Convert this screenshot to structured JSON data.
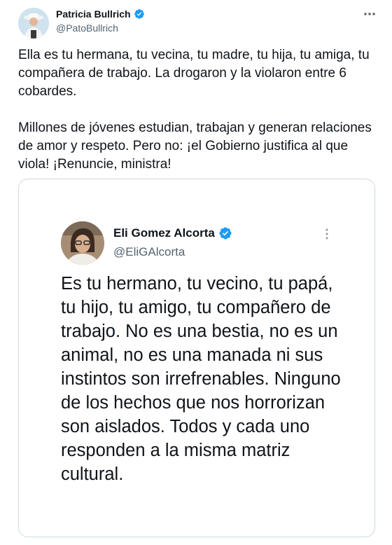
{
  "author": {
    "display_name": "Patricia Bullrich",
    "handle": "@PatoBullrich"
  },
  "tweet": {
    "paragraph_1": "Ella es tu hermana, tu vecina, tu madre, tu hija, tu amiga, tu compañera de trabajo. La drogaron y la violaron entre 6 cobardes.",
    "paragraph_2": "Millones de jóvenes estudian, trabajan y generan relaciones de amor y respeto. Pero no: ¡el Gobierno justifica al que viola! ¡Renuncie, ministra!"
  },
  "quoted": {
    "display_name": "Eli Gomez Alcorta",
    "handle": "@EliGAlcorta",
    "text": "Es tu hermano, tu vecino, tu papá, tu hijo, tu amigo, tu compañero de trabajo. No es una bestia, no es un animal, no es una manada ni sus instintos son irrefrenables. Ninguno de los hechos que nos horrorizan son aislados. Todos y cada uno responden a la misma matriz cultural."
  },
  "icons": {
    "verified": "verified-badge-icon",
    "more": "more-options-icon"
  },
  "colors": {
    "verified_blue": "#1d9bf0",
    "secondary_text": "#536471",
    "border": "#cfd9de"
  }
}
